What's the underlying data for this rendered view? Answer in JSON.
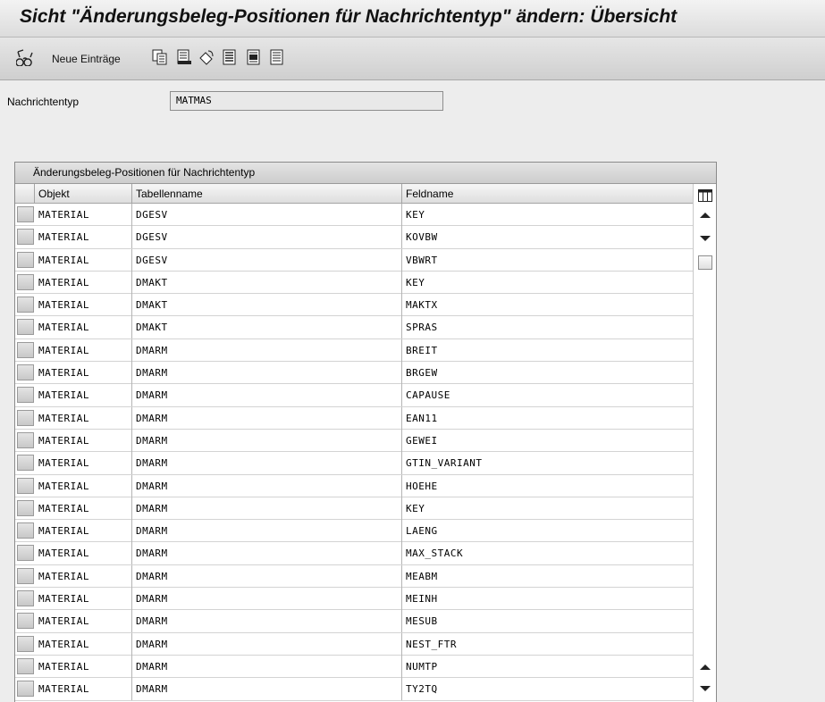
{
  "title": "Sicht \"Änderungsbeleg-Positionen für Nachrichtentyp\" ändern: Übersicht",
  "toolbar": {
    "neue_eintraege_label": "Neue Einträge",
    "icons": [
      "glasses-icon",
      "copy-icon",
      "delete-icon",
      "undo-icon",
      "select-all-icon",
      "select-block-icon",
      "deselect-all-icon"
    ]
  },
  "form": {
    "nachrichtentyp_label": "Nachrichtentyp",
    "nachrichtentyp_value": "MATMAS"
  },
  "table": {
    "title": "Änderungsbeleg-Positionen für Nachrichtentyp",
    "columns": [
      "Objekt",
      "Tabellenname",
      "Feldname"
    ],
    "rows": [
      [
        "MATERIAL",
        "DGESV",
        "KEY"
      ],
      [
        "MATERIAL",
        "DGESV",
        "KOVBW"
      ],
      [
        "MATERIAL",
        "DGESV",
        "VBWRT"
      ],
      [
        "MATERIAL",
        "DMAKT",
        "KEY"
      ],
      [
        "MATERIAL",
        "DMAKT",
        "MAKTX"
      ],
      [
        "MATERIAL",
        "DMAKT",
        "SPRAS"
      ],
      [
        "MATERIAL",
        "DMARM",
        "BREIT"
      ],
      [
        "MATERIAL",
        "DMARM",
        "BRGEW"
      ],
      [
        "MATERIAL",
        "DMARM",
        "CAPAUSE"
      ],
      [
        "MATERIAL",
        "DMARM",
        "EAN11"
      ],
      [
        "MATERIAL",
        "DMARM",
        "GEWEI"
      ],
      [
        "MATERIAL",
        "DMARM",
        "GTIN_VARIANT"
      ],
      [
        "MATERIAL",
        "DMARM",
        "HOEHE"
      ],
      [
        "MATERIAL",
        "DMARM",
        "KEY"
      ],
      [
        "MATERIAL",
        "DMARM",
        "LAENG"
      ],
      [
        "MATERIAL",
        "DMARM",
        "MAX_STACK"
      ],
      [
        "MATERIAL",
        "DMARM",
        "MEABM"
      ],
      [
        "MATERIAL",
        "DMARM",
        "MEINH"
      ],
      [
        "MATERIAL",
        "DMARM",
        "MESUB"
      ],
      [
        "MATERIAL",
        "DMARM",
        "NEST_FTR"
      ],
      [
        "MATERIAL",
        "DMARM",
        "NUMTP"
      ],
      [
        "MATERIAL",
        "DMARM",
        "TY2TQ"
      ]
    ]
  }
}
